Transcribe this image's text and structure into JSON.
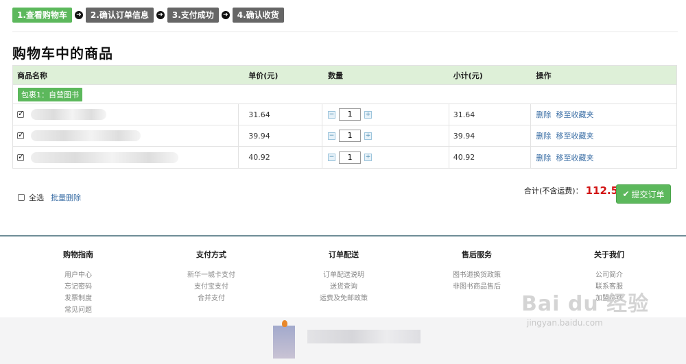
{
  "steps": [
    {
      "label": "1.查看购物车",
      "active": true
    },
    {
      "label": "2.确认订单信息",
      "active": false
    },
    {
      "label": "3.支付成功",
      "active": false
    },
    {
      "label": "4.确认收货",
      "active": false
    }
  ],
  "page_title": "购物车中的商品",
  "table": {
    "headers": {
      "name": "商品名称",
      "price": "单价(元)",
      "qty": "数量",
      "subtotal": "小计(元)",
      "actions": "操作"
    },
    "package_label": "包裹1：自营图书",
    "items": [
      {
        "price": "31.64",
        "qty": "1",
        "subtotal": "31.64",
        "delete": "删除",
        "favorite": "移至收藏夹"
      },
      {
        "price": "39.94",
        "qty": "1",
        "subtotal": "39.94",
        "delete": "删除",
        "favorite": "移至收藏夹"
      },
      {
        "price": "40.92",
        "qty": "1",
        "subtotal": "40.92",
        "delete": "删除",
        "favorite": "移至收藏夹"
      }
    ]
  },
  "select_all_label": "全选",
  "batch_delete_label": "批量删除",
  "total_label": "合计(不含运费)：",
  "total_amount": "112.50",
  "submit_label": "提交订单",
  "footer": [
    {
      "title": "购物指南",
      "links": [
        "用户中心",
        "忘记密码",
        "发票制度",
        "常见问题"
      ]
    },
    {
      "title": "支付方式",
      "links": [
        "新华一城卡支付",
        "支付宝支付",
        "合并支付"
      ]
    },
    {
      "title": "订单配送",
      "links": [
        "订单配送说明",
        "送货查询",
        "运费及免邮政策"
      ]
    },
    {
      "title": "售后服务",
      "links": [
        "图书退换货政策",
        "非图书商品售后"
      ]
    },
    {
      "title": "关于我们",
      "links": [
        "公司简介",
        "联系客服",
        "加盟热线"
      ]
    }
  ],
  "watermark": {
    "main": "Bai du 经验",
    "sub": "jingyan.baidu.com"
  },
  "colors": {
    "accent": "#5cb85c",
    "price_red": "#d21414",
    "link": "#3a6ea5"
  }
}
